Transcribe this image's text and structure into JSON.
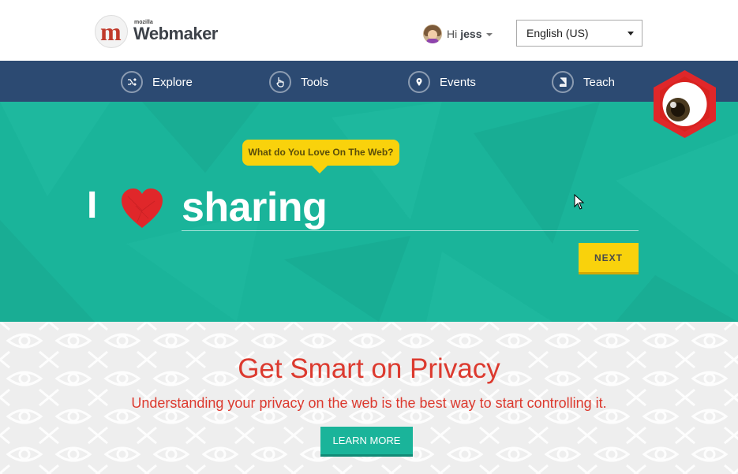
{
  "header": {
    "logo_small": "mozilla",
    "logo_text": "Webmaker",
    "greeting": "Hi",
    "username": "jess",
    "language": "English (US)"
  },
  "nav": {
    "items": [
      {
        "label": "Explore",
        "icon": "shuffle-icon"
      },
      {
        "label": "Tools",
        "icon": "pointer-hand-icon"
      },
      {
        "label": "Events",
        "icon": "map-pin-icon"
      },
      {
        "label": "Teach",
        "icon": "book-icon"
      }
    ]
  },
  "hero": {
    "prompt": "What do You Love On The Web?",
    "prefix": "I",
    "heart_icon": "heart-icon",
    "word": "sharing",
    "next_label": "NEXT"
  },
  "privacy": {
    "title": "Get Smart on Privacy",
    "subtitle": "Understanding your privacy on the web is the best way to start controlling it.",
    "button_label": "LEARN MORE"
  },
  "colors": {
    "nav_bg": "#2c4a72",
    "hero_bg": "#1ab49a",
    "accent_yellow": "#f9d20c",
    "privacy_red": "#dc3a2f"
  }
}
